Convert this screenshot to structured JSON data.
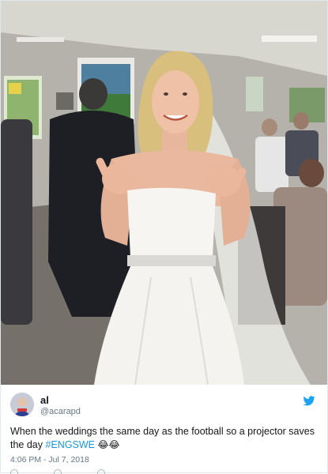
{
  "tweet": {
    "display_name": "al",
    "handle": "@acarapd",
    "text": {
      "body": "When the weddings the same day as the football so a projector saves the day",
      "hashtag": "#ENGSWE",
      "emoji": "😂😂"
    },
    "timestamp": "4:06 PM - Jul 7, 2018"
  },
  "icons": {
    "platform": "twitter-bird-icon",
    "avatar": "avatar",
    "actions": [
      "reply-icon",
      "retweet-icon",
      "like-icon",
      "message-icon"
    ]
  },
  "colors": {
    "link": "#1b95e0",
    "bird": "#1da1f2",
    "secondary_text": "#657786",
    "primary_text": "#14171a"
  }
}
